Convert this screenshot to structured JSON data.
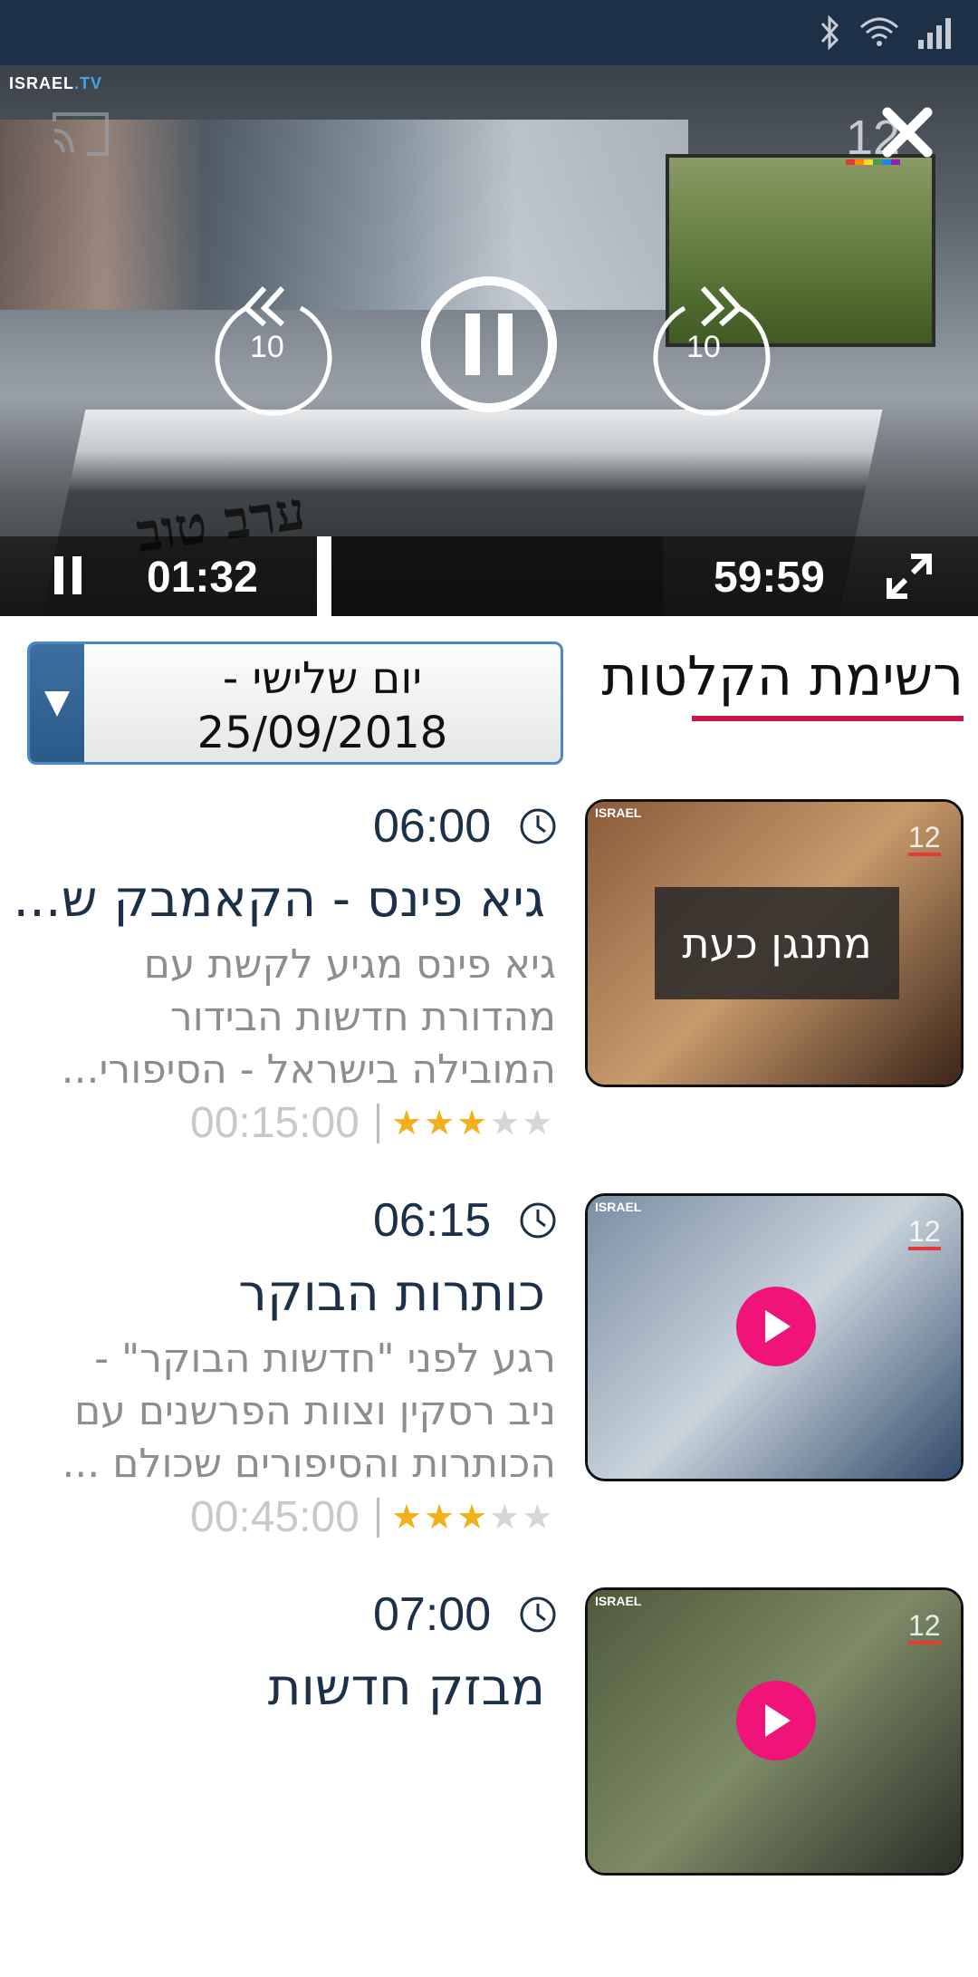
{
  "status_bar": {
    "icons": [
      "bluetooth-icon",
      "wifi-icon",
      "signal-icon"
    ]
  },
  "player": {
    "logo": {
      "main": "ISRAEL",
      "accent": ".TV"
    },
    "rewind_seconds": "10",
    "forward_seconds": "10",
    "current_time": "01:32",
    "total_time": "59:59",
    "desk_text": "ערב טוב",
    "progress_fraction": 0.026
  },
  "schedule": {
    "title": "רשימת הקלטות",
    "date_line1": "יום שלישי -",
    "date_line2": "25/09/2018"
  },
  "programs": [
    {
      "time": "06:00",
      "title": "גיא פינס - הקאמבק ש...",
      "description_lines": [
        "גיא פינס מגיע לקשת עם",
        "מהדורת חדשות הבידור",
        "המובילה בישראל - הסיפורי..."
      ],
      "rating": 3,
      "rating_max": 5,
      "duration": "00:15:00",
      "now_playing_label": "מתנגן כעת",
      "thumb_colors": [
        "#8b5a3c",
        "#c89a6c",
        "#3b2418"
      ]
    },
    {
      "time": "06:15",
      "title": "כותרות הבוקר",
      "description_lines": [
        "רגע לפני \"חדשות הבוקר\" -",
        "ניב רסקין וצוות הפרשנים עם",
        "הכותרות והסיפורים שכולם ..."
      ],
      "rating": 3,
      "rating_max": 5,
      "duration": "00:45:00",
      "now_playing_label": "",
      "thumb_colors": [
        "#7a8ea4",
        "#c9d4dc",
        "#304a6a"
      ]
    },
    {
      "time": "07:00",
      "title": "מבזק חדשות",
      "description_lines": [],
      "rating": 0,
      "rating_max": 5,
      "duration": "",
      "now_playing_label": "",
      "thumb_colors": [
        "#4e5a3a",
        "#7d8a66",
        "#2a2e26"
      ]
    }
  ],
  "colors": {
    "status_bar": "#1c3148",
    "accent_underline": "#c8174a",
    "play_button": "#f0137a",
    "star_on": "#f2b01b",
    "title_text": "#1c3148"
  }
}
